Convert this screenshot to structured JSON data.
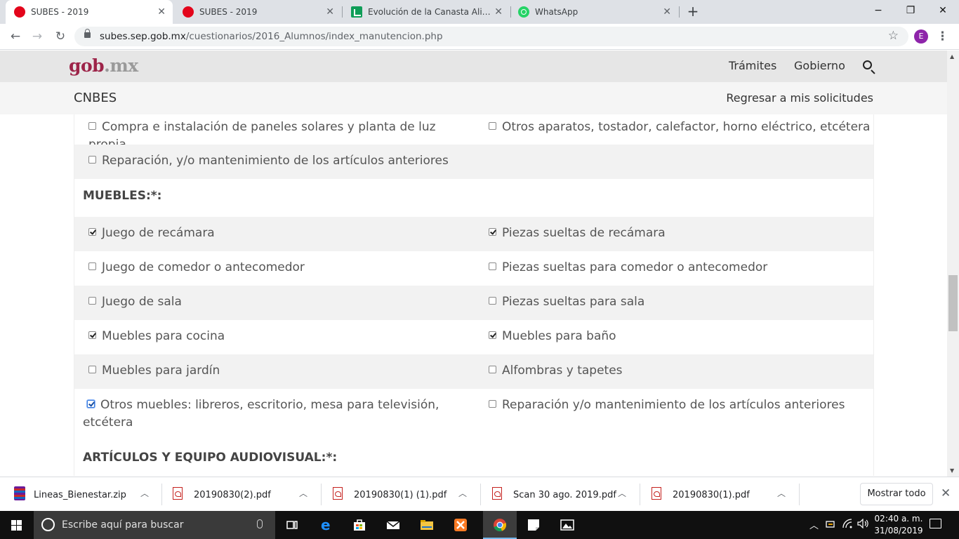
{
  "browser": {
    "tabs": [
      {
        "title": "SUBES - 2019",
        "icon": "subes-favicon",
        "active": true
      },
      {
        "title": "SUBES - 2019",
        "icon": "subes-favicon",
        "active": false
      },
      {
        "title": "Evolución de la Canasta Alimenta",
        "icon": "sheets-favicon",
        "active": false
      },
      {
        "title": "WhatsApp",
        "icon": "whatsapp-favicon",
        "active": false
      }
    ],
    "new_tab": "+",
    "url_host": "subes.sep.gob.mx",
    "url_path": "/cuestionarios/2016_Alumnos/index_manutencion.php",
    "profile_initial": "E",
    "window_controls": {
      "minimize": "−",
      "restore": "❐",
      "close": "✕"
    }
  },
  "header": {
    "logo_main": "gob",
    "logo_suffix": ".mx",
    "nav": [
      "Trámites",
      "Gobierno"
    ],
    "subtitle": "CNBES",
    "back_link": "Regresar a mis solicitudes"
  },
  "form": {
    "top_rows": [
      {
        "left": {
          "label": "Compra e instalación de paneles solares y planta de luz propia",
          "checked": false
        },
        "right": {
          "label": "Otros aparatos, tostador, calefactor, horno eléctrico, etcétera",
          "checked": false
        }
      },
      {
        "left": {
          "label": "Reparación, y/o mantenimiento de los artículos anteriores",
          "checked": false
        },
        "right": null
      }
    ],
    "muebles_heading": "MUEBLES:*:",
    "muebles_rows": [
      {
        "left": {
          "label": "Juego de recámara",
          "checked": true
        },
        "right": {
          "label": "Piezas sueltas de recámara",
          "checked": true
        }
      },
      {
        "left": {
          "label": "Juego de comedor o antecomedor",
          "checked": false
        },
        "right": {
          "label": "Piezas sueltas para comedor o antecomedor",
          "checked": false
        }
      },
      {
        "left": {
          "label": "Juego de sala",
          "checked": false
        },
        "right": {
          "label": "Piezas sueltas para sala",
          "checked": false
        }
      },
      {
        "left": {
          "label": "Muebles para cocina",
          "checked": true
        },
        "right": {
          "label": "Muebles para baño",
          "checked": true
        }
      },
      {
        "left": {
          "label": "Muebles para jardín",
          "checked": false
        },
        "right": {
          "label": "Alfombras y tapetes",
          "checked": false
        }
      },
      {
        "left": {
          "label": "Otros muebles: libreros, escritorio, mesa para televisión, etcétera",
          "checked": true
        },
        "right": {
          "label": "Reparación y/o mantenimiento de los artículos anteriores",
          "checked": false
        }
      }
    ],
    "audiovisual_heading": "ARTÍCULOS Y EQUIPO AUDIOVISUAL:*:"
  },
  "downloads": {
    "items": [
      {
        "name": "Lineas_Bienestar.zip",
        "type": "zip"
      },
      {
        "name": "20190830(2).pdf",
        "type": "pdf"
      },
      {
        "name": "20190830(1) (1).pdf",
        "type": "pdf"
      },
      {
        "name": "Scan 30 ago. 2019.pdf",
        "type": "pdf"
      },
      {
        "name": "20190830(1).pdf",
        "type": "pdf"
      }
    ],
    "show_all": "Mostrar todo",
    "close": "✕"
  },
  "taskbar": {
    "search_placeholder": "Escribe aquí para buscar",
    "apps": [
      "task-view",
      "edge",
      "store",
      "mail",
      "file-explorer",
      "xampp",
      "chrome",
      "sticky-notes",
      "photos"
    ],
    "active_app": "chrome",
    "time": "02:40 a. m.",
    "date": "31/08/2019"
  }
}
